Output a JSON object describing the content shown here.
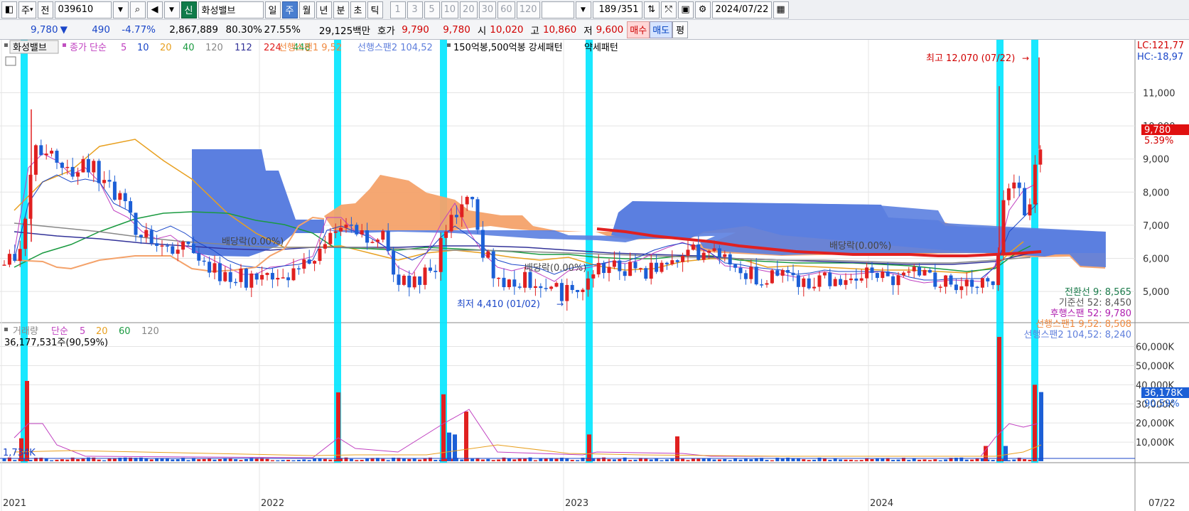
{
  "toolbar": {
    "period_label": "주",
    "prev_label": "전",
    "code": "039610",
    "badge": "신",
    "stock_name": "화성밸브",
    "period_tabs": [
      "일",
      "주",
      "월",
      "년",
      "분",
      "초",
      "틱"
    ],
    "selected_period": "주",
    "intervals": [
      "1",
      "3",
      "5",
      "10",
      "20",
      "30",
      "60",
      "120"
    ],
    "count": "189",
    "total": "/351",
    "date": "2024/07/22"
  },
  "quote": {
    "price": "9,780",
    "arrow": "▼",
    "change": "490",
    "change_pct": "-4.77%",
    "volume": "2,867,889",
    "ratio1": "80.30%",
    "ratio2": "27.55%",
    "amount": "29,125백만",
    "ask_label": "호가",
    "ask": "9,790",
    "bid": "9,780",
    "open_label": "시",
    "open": "10,020",
    "high_label": "고",
    "high": "10,860",
    "low_label": "저",
    "low": "9,600",
    "buy_label": "매수",
    "sell_label": "매도",
    "eval_label": "평"
  },
  "legend": {
    "name": "화성밸브",
    "ma_title": "종가 단순",
    "ma_periods": [
      "5",
      "10",
      "20",
      "40",
      "120",
      "112",
      "224",
      "448"
    ],
    "span1": "선행스팬1 9,52",
    "span2": "선행스팬2 104,52",
    "pattern": "150억봉,500억봉 강세패턴",
    "weak": "약세패턴"
  },
  "annotations": {
    "high_note": "최고 12,070 (07/22)",
    "low_note": "최저 4,410 (01/02)",
    "div1": "배당락(0.00%)",
    "div2": "배당락(0.00%)",
    "div3": "배당락(0.00%)",
    "lc": "LC:121,77",
    "hc": "HC:-18,97",
    "price_box": "9,780",
    "price_pct": "5.39%"
  },
  "indicators": [
    {
      "label": "전환선 9: 8,565",
      "color": "#1a7a4a"
    },
    {
      "label": "기준선 52: 8,450",
      "color": "#555555"
    },
    {
      "label": "후행스팬 52: 9,780",
      "color": "#b020b0"
    },
    {
      "label": "선행스팬1 9,52: 8,508",
      "color": "#f08a40"
    },
    {
      "label": "선행스팬2 104,52: 8,240",
      "color": "#5f7fdc"
    }
  ],
  "volume_legend": {
    "title": "거래량",
    "ma": "단순",
    "periods": [
      "5",
      "20",
      "60",
      "120"
    ],
    "total": "36,177,531주(90,59%)",
    "left_value": "1,734K",
    "box_value": "36,178K",
    "box_pct": "90,59%"
  },
  "price_axis": [
    "11,000",
    "10,000",
    "9,000",
    "8,000",
    "7,000",
    "6,000",
    "5,000"
  ],
  "volume_axis": [
    "60,000K",
    "50,000K",
    "40,000K",
    "30,000K",
    "20,000K",
    "10,000K"
  ],
  "time_axis": [
    "2021",
    "2022",
    "2023",
    "2024"
  ],
  "time_axis_end": "07/22",
  "chart_data": {
    "type": "candlestick",
    "price_range": [
      4100,
      12600
    ],
    "volume_range": [
      0,
      68000
    ],
    "scale_notes": "weekly candles, ichimoku cloud, moving averages",
    "closes_approx": [
      5800,
      8900,
      7900,
      6200,
      5400,
      6900,
      6600,
      5200,
      7300,
      5300,
      5000,
      5500,
      5600,
      5400,
      5200,
      5150,
      9780
    ],
    "volume_spikes": [
      {
        "period": "2021-01",
        "value": 42000
      },
      {
        "period": "2022-01",
        "value": 36000
      },
      {
        "period": "2022-05",
        "value": 35000
      },
      {
        "period": "2022-06",
        "value": 26000
      },
      {
        "period": "2023-01",
        "value": 14000
      },
      {
        "period": "2024-07a",
        "value": 65000
      },
      {
        "period": "2024-07b",
        "value": 40000
      },
      {
        "period": "2024-07c",
        "value": 36178
      }
    ],
    "cyan_marks": [
      "2021-01",
      "2022-01",
      "2022-05",
      "2023-01",
      "2024-06",
      "2024-07"
    ],
    "colors": {
      "up": "#e02020",
      "down": "#1c5fd6",
      "cloud_up": "#5b7fe0",
      "cloud_down": "#f4a26a",
      "cyan": "#00e5ff"
    }
  }
}
